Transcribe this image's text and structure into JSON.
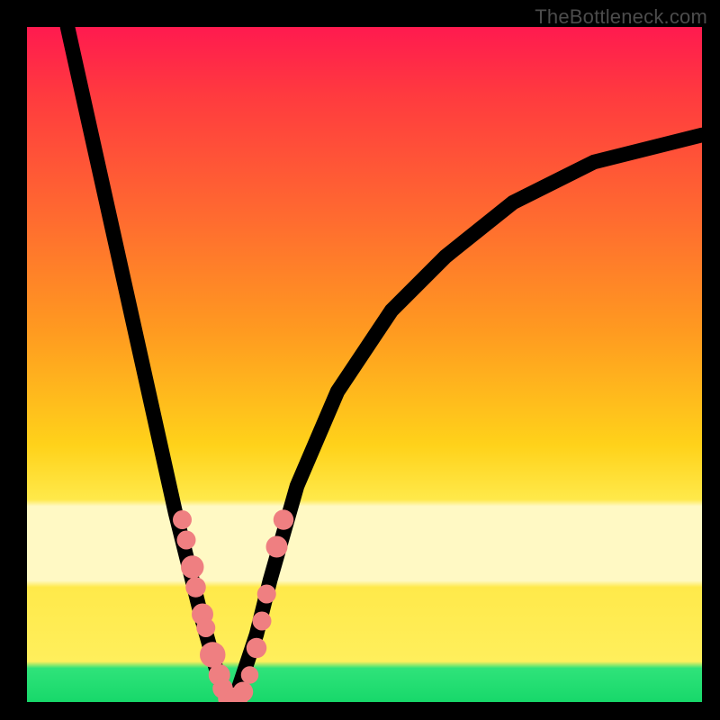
{
  "watermark": "TheBottleneck.com",
  "chart_data": {
    "type": "line",
    "title": "",
    "xlabel": "",
    "ylabel": "",
    "xlim": [
      0,
      100
    ],
    "ylim": [
      0,
      100
    ],
    "grid": false,
    "legend": false,
    "series": [
      {
        "name": "bottleneck-curve",
        "x": [
          6,
          10,
          14,
          18,
          22,
          24,
          26,
          28,
          29,
          30,
          31,
          32,
          34,
          36,
          40,
          46,
          54,
          62,
          72,
          84,
          100
        ],
        "y": [
          100,
          82,
          64,
          46,
          28,
          20,
          12,
          5,
          2,
          0,
          1,
          4,
          10,
          18,
          32,
          46,
          58,
          66,
          74,
          80,
          84
        ]
      }
    ],
    "markers": [
      {
        "x": 23.0,
        "y": 27.0,
        "r": 1.4
      },
      {
        "x": 23.6,
        "y": 24.0,
        "r": 1.4
      },
      {
        "x": 24.5,
        "y": 20.0,
        "r": 1.7
      },
      {
        "x": 25.0,
        "y": 17.0,
        "r": 1.5
      },
      {
        "x": 26.0,
        "y": 13.0,
        "r": 1.6
      },
      {
        "x": 26.5,
        "y": 11.0,
        "r": 1.4
      },
      {
        "x": 27.5,
        "y": 7.0,
        "r": 1.9
      },
      {
        "x": 28.5,
        "y": 4.0,
        "r": 1.6
      },
      {
        "x": 29.0,
        "y": 2.0,
        "r": 1.5
      },
      {
        "x": 30.0,
        "y": 0.5,
        "r": 1.7
      },
      {
        "x": 31.0,
        "y": 0.5,
        "r": 1.7
      },
      {
        "x": 32.0,
        "y": 1.5,
        "r": 1.5
      },
      {
        "x": 33.0,
        "y": 4.0,
        "r": 1.3
      },
      {
        "x": 34.0,
        "y": 8.0,
        "r": 1.5
      },
      {
        "x": 34.8,
        "y": 12.0,
        "r": 1.4
      },
      {
        "x": 35.5,
        "y": 16.0,
        "r": 1.4
      },
      {
        "x": 37.0,
        "y": 23.0,
        "r": 1.6
      },
      {
        "x": 38.0,
        "y": 27.0,
        "r": 1.5
      }
    ],
    "annotations": []
  }
}
